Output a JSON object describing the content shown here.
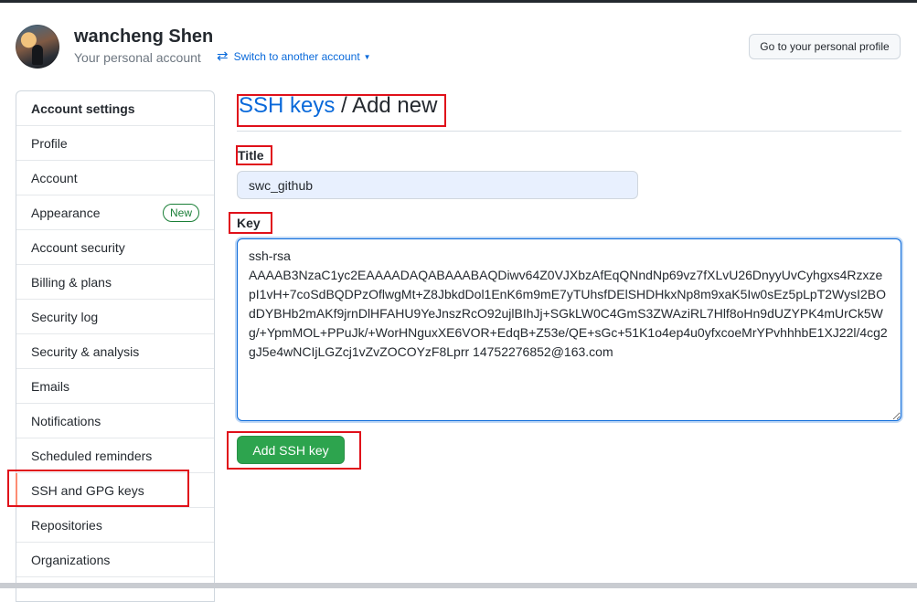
{
  "header": {
    "user_name": "wancheng Shen",
    "subtitle": "Your personal account",
    "switch_label": "Switch to another account",
    "profile_button": "Go to your personal profile"
  },
  "sidebar": {
    "heading": "Account settings",
    "items": [
      {
        "label": "Profile"
      },
      {
        "label": "Account"
      },
      {
        "label": "Appearance",
        "badge": "New"
      },
      {
        "label": "Account security"
      },
      {
        "label": "Billing & plans"
      },
      {
        "label": "Security log"
      },
      {
        "label": "Security & analysis"
      },
      {
        "label": "Emails"
      },
      {
        "label": "Notifications"
      },
      {
        "label": "Scheduled reminders"
      },
      {
        "label": "SSH and GPG keys",
        "selected": true
      },
      {
        "label": "Repositories"
      },
      {
        "label": "Organizations"
      }
    ]
  },
  "main": {
    "breadcrumb_link": "SSH keys",
    "breadcrumb_rest": " / Add new",
    "title_label": "Title",
    "title_value": "swc_github",
    "key_label": "Key",
    "key_value": "ssh-rsa\nAAAAB3NzaC1yc2EAAAADAQABAAABAQDiwv64Z0VJXbzAfEqQNndNp69vz7fXLvU26DnyyUvCyhgxs4RzxzepI1vH+7coSdBQDPzOflwgMt+Z8JbkdDol1EnK6m9mE7yTUhsfDElSHDHkxNp8m9xaK5Iw0sEz5pLpT2WysI2BOdDYBHb2mAKf9jrnDlHFAHU9YeJnszRcO92ujlBIhJj+SGkLW0C4GmS3ZWAziRL7Hlf8oHn9dUZYPK4mUrCk5Wg/+YpmMOL+PPuJk/+WorHNguxXE6VOR+EdqB+Z53e/QE+sGc+51K1o4ep4u0yfxcoeMrYPvhhhbE1XJ22l/4cg2gJ5e4wNCIjLGZcj1vZvZOCOYzF8Lprr 14752276852@163.com",
    "submit_label": "Add SSH key"
  },
  "colors": {
    "link": "#0969da",
    "primary_button": "#2da44e",
    "annotation": "#e0101a",
    "selected_marker": "#fd8c73",
    "badge": "#1a7f37"
  },
  "icons": {
    "switch": "arrows-switch-icon",
    "caret": "caret-down-icon"
  }
}
